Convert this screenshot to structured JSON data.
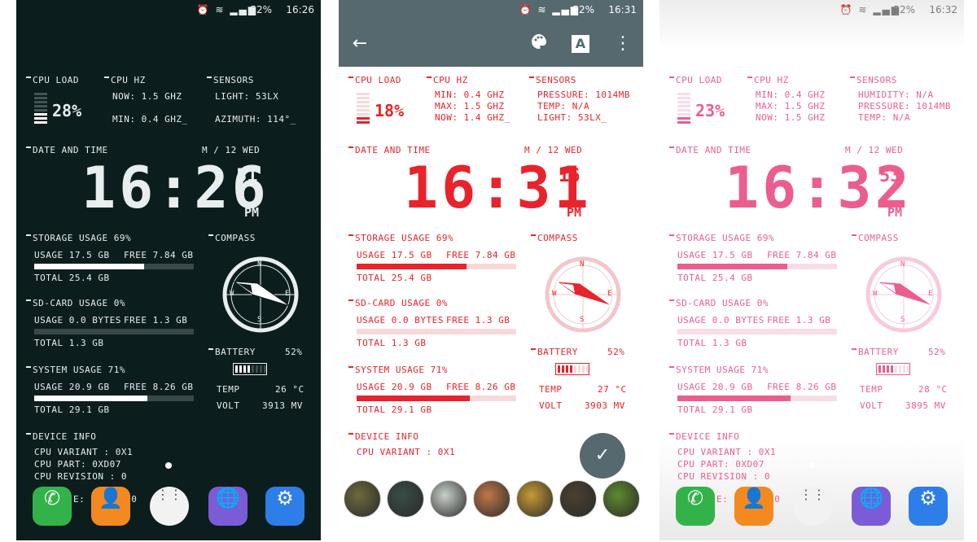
{
  "screens": [
    {
      "status": {
        "icons": "⏰ ≋ ▂▄▆",
        "battery": "52%",
        "time": "16:26"
      },
      "cpu_load": {
        "label": "CPU LOAD",
        "value": "28%",
        "level": 0.28
      },
      "cpu_hz": {
        "label": "CPU HZ",
        "lines": [
          "NOW: 1.5 GHZ",
          "",
          "MIN: 0.4 GHZ_"
        ]
      },
      "sensors": {
        "label": "SENSORS",
        "lines": [
          "LIGHT: 53LX",
          "",
          "AZIMUTH: 114°_"
        ]
      },
      "date": {
        "label": "DATE AND TIME",
        "day": "M / 12 WED",
        "clock": "16:26",
        "seconds": "51",
        "ampm": "PM"
      },
      "storage": {
        "label": "STORAGE USAGE 69%",
        "usage": "USAGE 17.5 GB",
        "free": "FREE 7.84 GB",
        "total": "TOTAL 25.4 GB",
        "fraction": 0.69
      },
      "sdcard": {
        "label": "SD-CARD USAGE 0%",
        "usage": "USAGE 0.0 BYTES",
        "free": "FREE 1.3 GB",
        "total": "TOTAL 1.3 GB",
        "fraction": 0.0
      },
      "system": {
        "label": "SYSTEM USAGE 71%",
        "usage": "USAGE 20.9 GB",
        "free": "FREE 8.26 GB",
        "total": "TOTAL 29.1 GB",
        "fraction": 0.71
      },
      "compass": {
        "label": "COMPASS",
        "n": "N",
        "s": "S",
        "w": "W",
        "e": "E"
      },
      "battery": {
        "label": "BATTERY",
        "value": "52%",
        "temp_label": "TEMP",
        "temp": "26 °C",
        "volt_label": "VOLT",
        "volt": "3913 MV",
        "level": 0.52
      },
      "device": {
        "label": "DEVICE INFO",
        "lines": [
          "CPU VARIANT : 0X1",
          "CPU PART: 0XD07",
          "CPU REVISION : 0"
        ],
        "partial": "E: SS EX 20"
      }
    },
    {
      "status": {
        "icons": "⏰ ≋ ▂▄▆",
        "battery": "52%",
        "time": "16:31"
      },
      "cpu_load": {
        "label": "CPU LOAD",
        "value": "18%",
        "level": 0.18
      },
      "cpu_hz": {
        "label": "CPU HZ",
        "lines": [
          "MIN: 0.4 GHZ",
          "MAX: 1.5 GHZ",
          "NOW: 1.4 GHZ_"
        ]
      },
      "sensors": {
        "label": "SENSORS",
        "lines": [
          "PRESSURE: 1014MB",
          "TEMP: N/A",
          "LIGHT: 53LX_"
        ]
      },
      "date": {
        "label": "DATE AND TIME",
        "day": "M / 12 WED",
        "clock": "16:31",
        "seconds": "16",
        "ampm": "PM"
      },
      "storage": {
        "label": "STORAGE USAGE 69%",
        "usage": "USAGE 17.5 GB",
        "free": "FREE 7.84 GB",
        "total": "TOTAL 25.4 GB",
        "fraction": 0.69
      },
      "sdcard": {
        "label": "SD-CARD USAGE 0%",
        "usage": "USAGE 0.0 BYTES",
        "free": "FREE 1.3 GB",
        "total": "TOTAL 1.3 GB",
        "fraction": 0.0
      },
      "system": {
        "label": "SYSTEM USAGE 71%",
        "usage": "USAGE 20.9 GB",
        "free": "FREE 8.26 GB",
        "total": "TOTAL 29.1 GB",
        "fraction": 0.71
      },
      "compass": {
        "label": "COMPASS",
        "n": "N",
        "s": "S",
        "w": "W",
        "e": "E"
      },
      "battery": {
        "label": "BATTERY",
        "value": "52%",
        "temp_label": "TEMP",
        "temp": "27 °C",
        "volt_label": "VOLT",
        "volt": "3903 MV",
        "level": 0.52
      },
      "device": {
        "label": "DEVICE INFO",
        "lines": [
          "CPU VARIANT : 0X1"
        ],
        "partial": ""
      }
    },
    {
      "status": {
        "icons": "⏰ ≋ ▂▄▆",
        "battery": "52%",
        "time": "16:32"
      },
      "cpu_load": {
        "label": "CPU LOAD",
        "value": "23%",
        "level": 0.23
      },
      "cpu_hz": {
        "label": "CPU HZ",
        "lines": [
          "MIN: 0.4 GHZ",
          "MAX: 1.5 GHZ",
          "NOW: 1.5 GHZ"
        ]
      },
      "sensors": {
        "label": "SENSORS",
        "lines": [
          "HUMIDITY: N/A",
          "PRESSURE: 1014MB",
          "TEMP: N/A"
        ]
      },
      "date": {
        "label": "DATE AND TIME",
        "day": "M / 12 WED",
        "clock": "16:32",
        "seconds": "53",
        "ampm": "PM"
      },
      "storage": {
        "label": "STORAGE USAGE 69%",
        "usage": "USAGE 17.5 GB",
        "free": "FREE 7.84 GB",
        "total": "TOTAL 25.4 GB",
        "fraction": 0.69
      },
      "sdcard": {
        "label": "SD-CARD USAGE 0%",
        "usage": "USAGE 0.0 BYTES",
        "free": "FREE 1.3 GB",
        "total": "TOTAL 1.3 GB",
        "fraction": 0.0
      },
      "system": {
        "label": "SYSTEM USAGE 71%",
        "usage": "USAGE 20.9 GB",
        "free": "FREE 8.26 GB",
        "total": "TOTAL 29.1 GB",
        "fraction": 0.71
      },
      "compass": {
        "label": "COMPASS",
        "n": "N",
        "s": "S",
        "w": "W",
        "e": "E"
      },
      "battery": {
        "label": "BATTERY",
        "value": "52%",
        "temp_label": "TEMP",
        "temp": "28 °C",
        "volt_label": "VOLT",
        "volt": "3895 MV",
        "level": 0.52
      },
      "device": {
        "label": "DEVICE INFO",
        "lines": [
          "CPU VARIANT : 0X1",
          "CPU PART: 0XD07",
          "CPU REVISION : 0"
        ],
        "partial": "E: SS EX 20"
      }
    }
  ],
  "editor": {
    "back_icon": "back-arrow-icon",
    "palette_icon": "palette-icon",
    "font_icon": "A",
    "more_icon": "more-vert-icon",
    "confirm_icon": "check-icon"
  },
  "dock_icons": [
    "phone-icon",
    "contacts-icon",
    "apps-icon",
    "browser-icon",
    "settings-icon"
  ],
  "thumbnails": [
    "wallpaper-1",
    "wallpaper-2",
    "wallpaper-3",
    "wallpaper-4",
    "wallpaper-5",
    "wallpaper-6",
    "wallpaper-7"
  ],
  "colors": {
    "dark_bg": "#0c1d1d",
    "red_accent": "#e8232b",
    "pink_accent": "#ec5d8f",
    "toolbar": "#56696e"
  }
}
